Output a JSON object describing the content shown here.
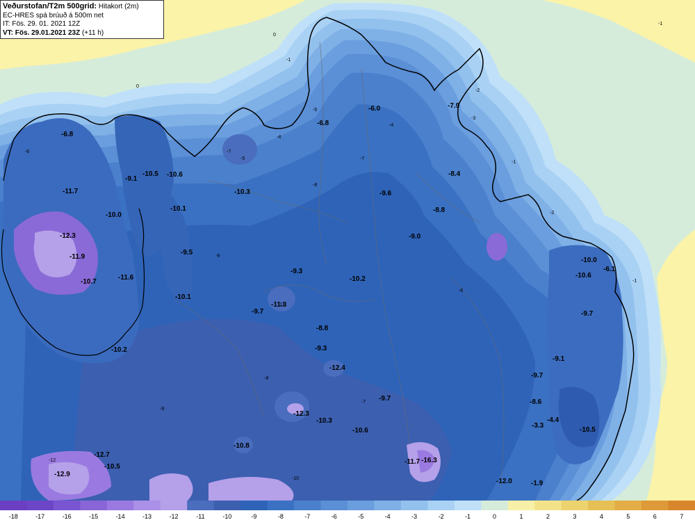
{
  "header": {
    "line1_bold": "Veðurstofan/T2m 500grid:",
    "line1_rest": "Hitakort (2m)",
    "line2": "EC-HRES spá brúuð á 500m net",
    "line3": "IT: Fös. 29. 01. 2021 12Z",
    "line4_bold": "VT: Fös. 29.01.2021 23Z",
    "line4_rest": "(+11 h)"
  },
  "colors": {
    "sea_land_green": "#d7ecd8",
    "ocean_yellow": "#fbf3a8",
    "scale": [
      {
        "value": "-18",
        "color": "#6a3fc2"
      },
      {
        "value": "-17",
        "color": "#6d46c8"
      },
      {
        "value": "-16",
        "color": "#7a55d2"
      },
      {
        "value": "-15",
        "color": "#8965d8"
      },
      {
        "value": "-14",
        "color": "#9a7ae0"
      },
      {
        "value": "-13",
        "color": "#aa90e6"
      },
      {
        "value": "-12",
        "color": "#b5a0ea"
      },
      {
        "value": "-11",
        "color": "#4a6dbd"
      },
      {
        "value": "-10",
        "color": "#3c5fb0"
      },
      {
        "value": "-9",
        "color": "#2e63b8"
      },
      {
        "value": "-8",
        "color": "#3a71c2"
      },
      {
        "value": "-7",
        "color": "#4a80cc"
      },
      {
        "value": "-6",
        "color": "#5b8fd6"
      },
      {
        "value": "-5",
        "color": "#6a9ede"
      },
      {
        "value": "-4",
        "color": "#7fb0e6"
      },
      {
        "value": "-3",
        "color": "#93c1ee"
      },
      {
        "value": "-2",
        "color": "#a9d1f4"
      },
      {
        "value": "-1",
        "color": "#bfe0f8"
      },
      {
        "value": "0",
        "color": "#d6ecda"
      },
      {
        "value": "1",
        "color": "#f7f0a6"
      },
      {
        "value": "2",
        "color": "#f2e38a"
      },
      {
        "value": "3",
        "color": "#ecd36e"
      },
      {
        "value": "4",
        "color": "#e6c055"
      },
      {
        "value": "5",
        "color": "#e2ad45"
      },
      {
        "value": "6",
        "color": "#de9a38"
      },
      {
        "value": "7",
        "color": "#d8862c"
      }
    ]
  },
  "map_labels": [
    {
      "name": "label-west-fjords-1",
      "text": "-6.8"
    },
    {
      "name": "label-west-fjords-2",
      "text": "-11.7"
    },
    {
      "name": "label-west-fjords-3",
      "text": "-12.3"
    },
    {
      "name": "label-west-fjords-4",
      "text": "-11.9"
    },
    {
      "name": "label-west-fjords-5",
      "text": "-10.7"
    },
    {
      "name": "label-west-fjords-6",
      "text": "-11.6"
    },
    {
      "name": "label-west-fjords-7",
      "text": "-10.0"
    },
    {
      "name": "label-west-fjords-8",
      "text": "-10.2"
    },
    {
      "name": "label-penin-1",
      "text": "-9.1"
    },
    {
      "name": "label-penin-2",
      "text": "-10.5"
    },
    {
      "name": "label-penin-3",
      "text": "-10.6"
    },
    {
      "name": "label-penin-4",
      "text": "-10.1"
    },
    {
      "name": "label-penin-5",
      "text": "-9.5"
    },
    {
      "name": "label-penin-6",
      "text": "-10.1"
    },
    {
      "name": "label-center-1",
      "text": "-6.8"
    },
    {
      "name": "label-center-2",
      "text": "-6.0"
    },
    {
      "name": "label-center-3",
      "text": "-7.9"
    },
    {
      "name": "label-center-4",
      "text": "-10.3"
    },
    {
      "name": "label-center-5",
      "text": "-9.6"
    },
    {
      "name": "label-center-6",
      "text": "-8.4"
    },
    {
      "name": "label-center-7",
      "text": "-8.8"
    },
    {
      "name": "label-center-8",
      "text": "-9.0"
    },
    {
      "name": "label-center-9",
      "text": "-9.3"
    },
    {
      "name": "label-center-10",
      "text": "-10.2"
    },
    {
      "name": "label-center-11",
      "text": "-11.3"
    },
    {
      "name": "label-center-12",
      "text": "-9.7"
    },
    {
      "name": "label-center-13",
      "text": "-8.8"
    },
    {
      "name": "label-center-14",
      "text": "-9.3"
    },
    {
      "name": "label-center-15",
      "text": "-12.4"
    },
    {
      "name": "label-center-16",
      "text": "-9.7"
    },
    {
      "name": "label-center-17",
      "text": "-12.3"
    },
    {
      "name": "label-center-18",
      "text": "-10.3"
    },
    {
      "name": "label-center-19",
      "text": "-10.6"
    },
    {
      "name": "label-center-20",
      "text": "-10.8"
    },
    {
      "name": "label-south-1",
      "text": "-12.7"
    },
    {
      "name": "label-south-2",
      "text": "-10.5"
    },
    {
      "name": "label-south-3",
      "text": "-12.9"
    },
    {
      "name": "label-south-4",
      "text": "-11.7"
    },
    {
      "name": "label-south-5",
      "text": "-16.3"
    },
    {
      "name": "label-south-6",
      "text": "-12.0"
    },
    {
      "name": "label-south-7",
      "text": "-1.9"
    },
    {
      "name": "label-east-1",
      "text": "-10.0"
    },
    {
      "name": "label-east-2",
      "text": "-6.1"
    },
    {
      "name": "label-east-3",
      "text": "-10.6"
    },
    {
      "name": "label-east-4",
      "text": "-9.7"
    },
    {
      "name": "label-east-5",
      "text": "-9.1"
    },
    {
      "name": "label-east-6",
      "text": "-9.7"
    },
    {
      "name": "label-east-7",
      "text": "-8.6"
    },
    {
      "name": "label-east-8",
      "text": "-4.4"
    },
    {
      "name": "label-east-9",
      "text": "-3.3"
    },
    {
      "name": "label-east-10",
      "text": "-10.5"
    }
  ],
  "contour_labels": [
    "0",
    "-1",
    "-2",
    "-3",
    "-4",
    "-5",
    "-6",
    "-7",
    "-8",
    "-9",
    "-10",
    "-11",
    "-12"
  ]
}
